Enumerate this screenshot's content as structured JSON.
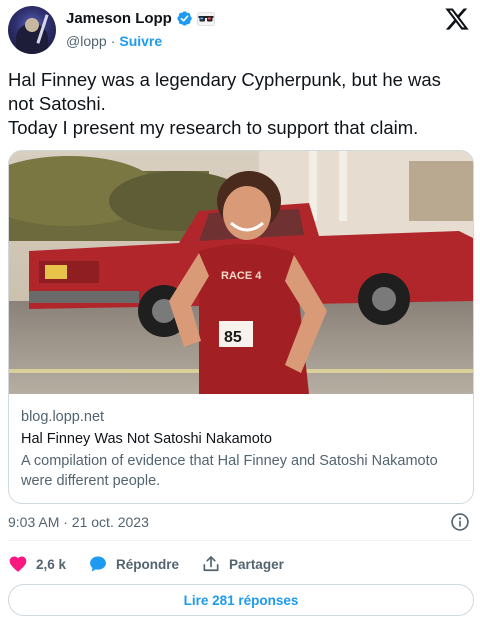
{
  "author": {
    "name": "Jameson Lopp",
    "handle": "@lopp",
    "separator": "·",
    "follow_label": "Suivre"
  },
  "tweet": {
    "lines": [
      "Hal Finney was a legendary Cypherpunk, but he was",
      "not Satoshi.",
      "Today I present my research to support that claim."
    ]
  },
  "card": {
    "domain": "blog.lopp.net",
    "title": "Hal Finney Was Not Satoshi Nakamoto",
    "description_lines": [
      "A compilation of evidence that Hal Finney and Satoshi Nakamoto",
      "were different people."
    ],
    "photo": {
      "shirt_text": "RACE 4",
      "bib_number": "85"
    }
  },
  "meta": {
    "timestamp": "9:03 AM · 21 oct. 2023"
  },
  "actions": {
    "like_count": "2,6 k",
    "reply_label": "Répondre",
    "share_label": "Partager"
  },
  "replies_button": "Lire 281 réponses",
  "colors": {
    "accent": "#1d9bf0",
    "like": "#f91880",
    "text": "#0f1419",
    "secondary": "#536471"
  },
  "icons": [
    "verified-badge-icon",
    "glasses-emoji-icon",
    "x-logo-icon",
    "info-icon",
    "heart-icon",
    "speech-bubble-icon",
    "share-icon"
  ]
}
